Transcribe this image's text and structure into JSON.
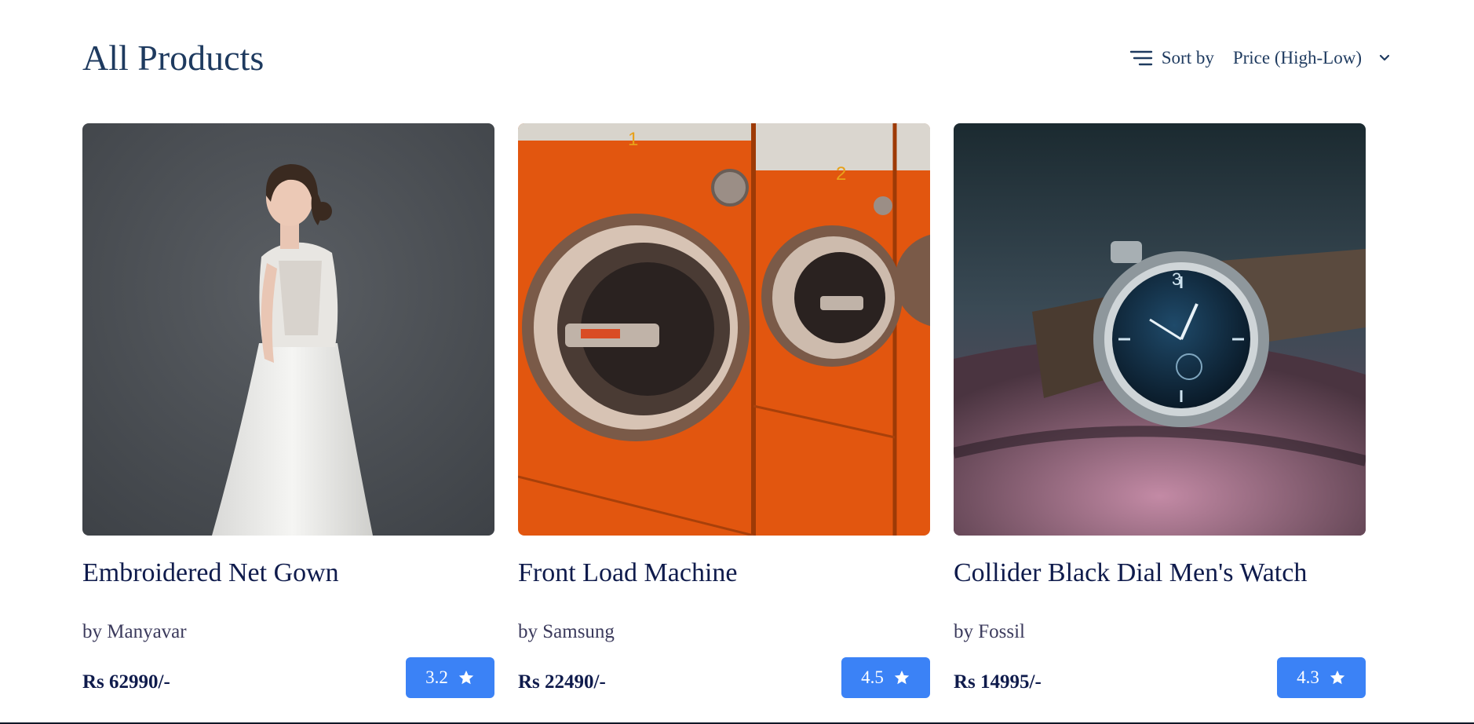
{
  "header": {
    "title": "All Products",
    "sort_label": "Sort by",
    "sort_value": "Price (High-Low)",
    "sort_icon": "sort-lines-icon",
    "chevron_icon": "chevron-down-icon"
  },
  "accent_color": "#3b82f6",
  "products": [
    {
      "title": "Embroidered Net Gown",
      "brand": "by Manyavar",
      "price": "Rs 62990/-",
      "rating": "3.2",
      "image": "bride-in-white-gown"
    },
    {
      "title": "Front Load Machine",
      "brand": "by Samsung",
      "price": "Rs 22490/-",
      "rating": "4.5",
      "image": "orange-washing-machines"
    },
    {
      "title": "Collider Black Dial Men's Watch",
      "brand": "by Fossil",
      "price": "Rs 14995/-",
      "rating": "4.3",
      "image": "wristwatch-on-leather"
    }
  ]
}
